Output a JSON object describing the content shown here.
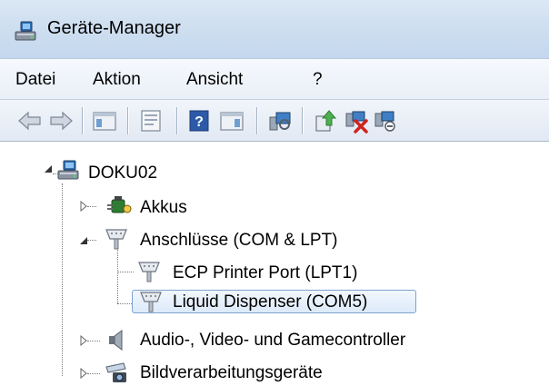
{
  "window": {
    "title": "Geräte-Manager"
  },
  "menu": {
    "items": [
      "Datei",
      "Aktion",
      "Ansicht",
      "?"
    ]
  },
  "toolbar": {
    "buttons": [
      "back-arrow-icon",
      "forward-arrow-icon",
      "show-hide-console-tree-icon",
      "properties-icon",
      "help-icon",
      "show-action-pane-icon",
      "scan-hardware-icon",
      "update-driver-icon",
      "disable-device-icon",
      "uninstall-device-icon"
    ]
  },
  "tree": {
    "root": {
      "label": "DOKU02",
      "icon": "computer-icon",
      "expanded": true
    },
    "nodes": [
      {
        "label": "Akkus",
        "icon": "battery-icon",
        "expanded": false
      },
      {
        "label": "Anschlüsse (COM & LPT)",
        "icon": "port-icon",
        "expanded": true,
        "children": [
          {
            "label": "ECP Printer Port (LPT1)",
            "icon": "port-icon",
            "selected": false
          },
          {
            "label": "Liquid Dispenser (COM5)",
            "icon": "port-icon",
            "selected": true
          }
        ]
      },
      {
        "label": "Audio-, Video- und Gamecontroller",
        "icon": "speaker-icon",
        "expanded": false
      },
      {
        "label": "Bildverarbeitungsgeräte",
        "icon": "camera-icon",
        "expanded": false
      }
    ]
  },
  "colors": {
    "selection_border": "#7da2ce",
    "titlebar": "#cfdff0"
  }
}
